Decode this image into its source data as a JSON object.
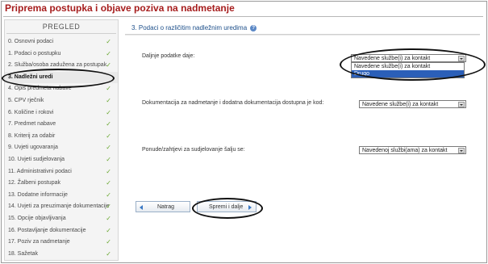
{
  "title": "Priprema postupka i objave poziva na nadmetanje",
  "sidebar": {
    "heading": "PREGLED",
    "items": [
      {
        "label": "0. Osnovni podaci",
        "done": true
      },
      {
        "label": "1. Podaci o postupku",
        "done": true
      },
      {
        "label": "2. Služba/osoba zadužena za postupak",
        "done": true
      },
      {
        "label": "3. Nadležni uredi",
        "done": false,
        "active": true
      },
      {
        "label": "4. Opis predmeta nabave",
        "done": true
      },
      {
        "label": "5. CPV rječnik",
        "done": true
      },
      {
        "label": "6. Količine i rokovi",
        "done": true
      },
      {
        "label": "7. Predmet nabave",
        "done": true
      },
      {
        "label": "8. Kriterij za odabir",
        "done": true
      },
      {
        "label": "9. Uvjeti ugovaranja",
        "done": true
      },
      {
        "label": "10. Uvjeti sudjelovanja",
        "done": true
      },
      {
        "label": "11. Administrativni podaci",
        "done": true
      },
      {
        "label": "12. Žalbeni postupak",
        "done": true
      },
      {
        "label": "13. Dodatne informacije",
        "done": true
      },
      {
        "label": "14. Uvjeti za preuzimanje dokumentacije",
        "done": true
      },
      {
        "label": "15. Opcije objavljivanja",
        "done": true
      },
      {
        "label": "16. Postavljanje dokumentacije",
        "done": true
      },
      {
        "label": "17. Poziv za nadmetanje",
        "done": true
      },
      {
        "label": "18. Sažetak",
        "done": true
      }
    ],
    "check_glyph": "✓"
  },
  "main": {
    "heading": "3. Podaci o različitim nadležnim uredima",
    "help_icon": "?",
    "fields": [
      {
        "label": "Daljnje podatke daje:",
        "value": "Navedene službe(i) za kontakt"
      },
      {
        "label": "Dokumentacija za nadmetanje i dodatna dokumentacija dostupna je kod:",
        "value": "Navedene službe(i) za kontakt"
      },
      {
        "label": "Ponude/zahtjevi za sudjelovanje šalju se:",
        "value": "Navedenoj službi(ama) za kontakt"
      }
    ],
    "dropdown_options": [
      "Navedene službe(i) za kontakt",
      "Drugo"
    ]
  },
  "buttons": {
    "back": "Natrag",
    "next": "Spremi i dalje"
  },
  "colors": {
    "title": "#a61d1d",
    "heading": "#1d4f8a",
    "check": "#6aa832",
    "selected_option": "#2b5fb8"
  }
}
